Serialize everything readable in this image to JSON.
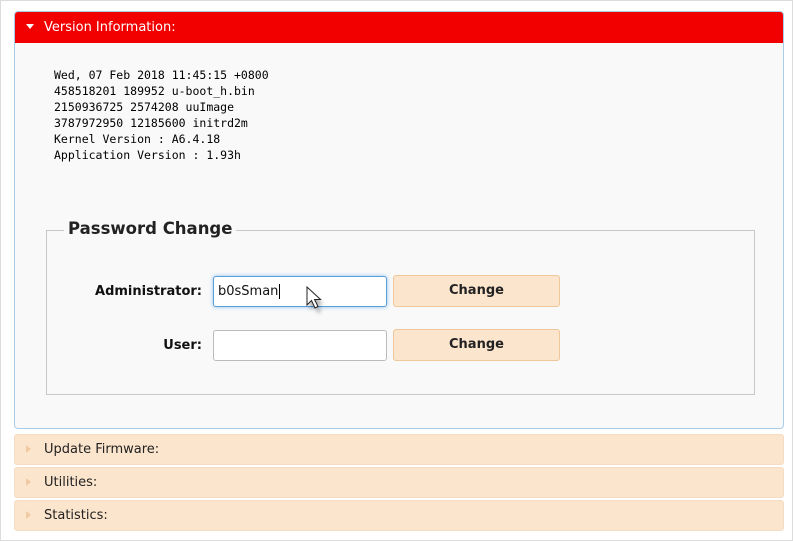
{
  "version_panel": {
    "title": "Version Information:",
    "lines": [
      "Wed, 07 Feb 2018 11:45:15 +0800",
      "458518201 189952 u-boot_h.bin",
      "2150936725 2574208 uuImage",
      "3787972950 12185600 initrd2m",
      "Kernel Version : A6.4.18",
      "Application Version : 1.93h"
    ]
  },
  "password_change": {
    "legend": "Password Change",
    "admin_label": "Administrator:",
    "admin_value": "b0sSman",
    "user_label": "User:",
    "user_value": "",
    "change_label": "Change"
  },
  "sections": {
    "update_firmware": "Update Firmware:",
    "utilities": "Utilities:",
    "statistics": "Statistics:"
  },
  "colors": {
    "header_red": "#f20000",
    "collapsed_bg": "#fbe5cd",
    "button_bg": "#fbe5cd",
    "panel_border": "#a9cde8"
  },
  "icons": {
    "expanded": "triangle-down-icon",
    "collapsed": "triangle-right-icon",
    "cursor": "mouse-pointer-icon"
  }
}
